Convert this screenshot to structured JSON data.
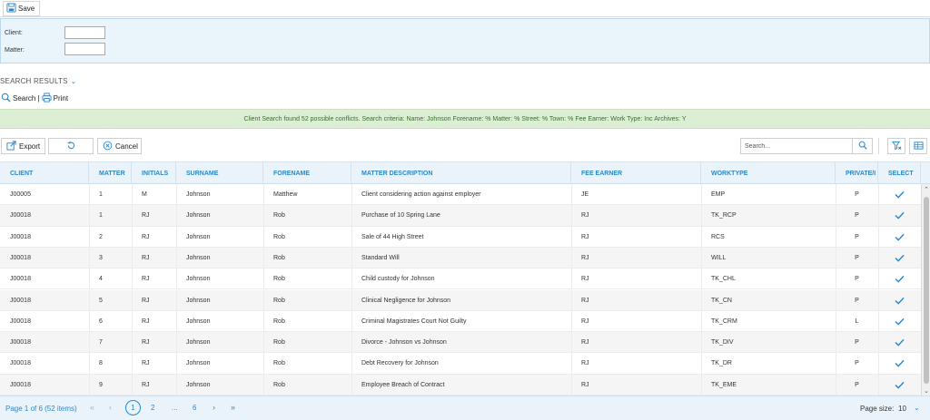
{
  "toolbar": {
    "save_label": "Save"
  },
  "filters": {
    "client_label": "Client:",
    "client_value": "",
    "matter_label": "Matter:",
    "matter_value": ""
  },
  "results": {
    "title": "SEARCH RESULTS",
    "search_label": "Search |",
    "print_label": "Print",
    "banner": "Client Search found 52 possible conflicts. Search criteria: Name: Johnson Forename: % Matter: % Street: % Town: % Fee Earner: Work Type: Inc Archives: Y"
  },
  "grid_toolbar": {
    "export_label": "Export",
    "cancel_label": "Cancel",
    "search_placeholder": "Search..."
  },
  "columns": [
    "CLIENT",
    "MATTER",
    "INITIALS",
    "SURNAME",
    "FORENAME",
    "MATTER DESCRIPTION",
    "FEE EARNER",
    "WORKTYPE",
    "PRIVATE/I",
    "SELECT"
  ],
  "rows": [
    {
      "client": "J00005",
      "matter": "1",
      "initials": "M",
      "surname": "Johnson",
      "forename": "Matthew",
      "description": "Client considering action against employer",
      "fee_earner": "JE",
      "worktype": "EMP",
      "private": "P",
      "selected": true
    },
    {
      "client": "J00018",
      "matter": "1",
      "initials": "RJ",
      "surname": "Johnson",
      "forename": "Rob",
      "description": "Purchase of 10 Spring Lane",
      "fee_earner": "RJ",
      "worktype": "TK_RCP",
      "private": "P",
      "selected": true
    },
    {
      "client": "J00018",
      "matter": "2",
      "initials": "RJ",
      "surname": "Johnson",
      "forename": "Rob",
      "description": "Sale of 44 High Street",
      "fee_earner": "RJ",
      "worktype": "RCS",
      "private": "P",
      "selected": true
    },
    {
      "client": "J00018",
      "matter": "3",
      "initials": "RJ",
      "surname": "Johnson",
      "forename": "Rob",
      "description": "Standard Will",
      "fee_earner": "RJ",
      "worktype": "WILL",
      "private": "P",
      "selected": true
    },
    {
      "client": "J00018",
      "matter": "4",
      "initials": "RJ",
      "surname": "Johnson",
      "forename": "Rob",
      "description": "Child custody for Johnson",
      "fee_earner": "RJ",
      "worktype": "TK_CHL",
      "private": "P",
      "selected": true
    },
    {
      "client": "J00018",
      "matter": "5",
      "initials": "RJ",
      "surname": "Johnson",
      "forename": "Rob",
      "description": "Clinical Negligence for Johnson",
      "fee_earner": "RJ",
      "worktype": "TK_CN",
      "private": "P",
      "selected": true
    },
    {
      "client": "J00018",
      "matter": "6",
      "initials": "RJ",
      "surname": "Johnson",
      "forename": "Rob",
      "description": "Criminal Magistrates Court Not Guilty",
      "fee_earner": "RJ",
      "worktype": "TK_CRM",
      "private": "L",
      "selected": true
    },
    {
      "client": "J00018",
      "matter": "7",
      "initials": "RJ",
      "surname": "Johnson",
      "forename": "Rob",
      "description": "Divorce - Johnson vs Johnson",
      "fee_earner": "RJ",
      "worktype": "TK_DIV",
      "private": "P",
      "selected": true
    },
    {
      "client": "J00018",
      "matter": "8",
      "initials": "RJ",
      "surname": "Johnson",
      "forename": "Rob",
      "description": "Debt Recovery for Johnson",
      "fee_earner": "RJ",
      "worktype": "TK_DR",
      "private": "P",
      "selected": true
    },
    {
      "client": "J00018",
      "matter": "9",
      "initials": "RJ",
      "surname": "Johnson",
      "forename": "Rob",
      "description": "Employee Breach of Contract",
      "fee_earner": "RJ",
      "worktype": "TK_EME",
      "private": "P",
      "selected": true
    }
  ],
  "pager": {
    "info": "Page 1 of 6 (52 items)",
    "first": "«",
    "prev": "‹",
    "current": "1",
    "page2": "2",
    "ellipsis": "...",
    "last_page": "6",
    "next": "›",
    "last": "»",
    "page_size_label": "Page size:",
    "page_size_value": "10",
    "chevron": "⌄"
  },
  "colors": {
    "accent": "#2b88c8",
    "header_bg": "#eaf3fa",
    "banner_bg": "#dcefd5",
    "filter_bg": "#eaf4fb"
  }
}
